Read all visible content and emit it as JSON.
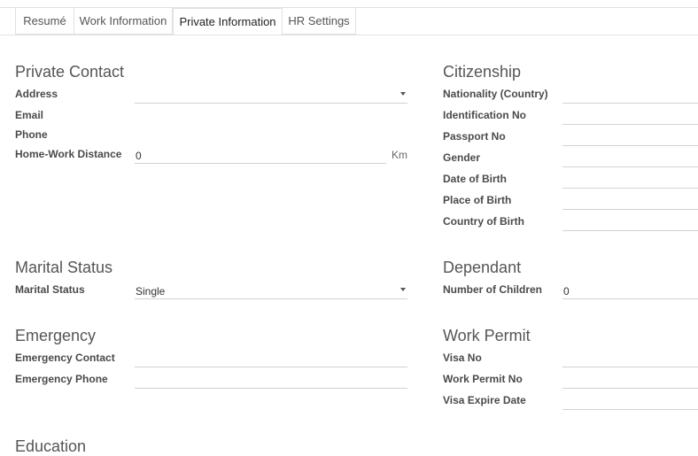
{
  "tabs": [
    "Resumé",
    "Work Information",
    "Private Information",
    "HR Settings"
  ],
  "private_contact": {
    "title": "Private Contact",
    "address_label": "Address",
    "email_label": "Email",
    "phone_label": "Phone",
    "distance_label": "Home-Work Distance",
    "distance_value": "0",
    "distance_unit": "Km"
  },
  "citizenship": {
    "title": "Citizenship",
    "nationality_label": "Nationality (Country)",
    "identification_label": "Identification No",
    "passport_label": "Passport No",
    "gender_label": "Gender",
    "dob_label": "Date of Birth",
    "pob_label": "Place of Birth",
    "cob_label": "Country of Birth"
  },
  "marital": {
    "title": "Marital Status",
    "label": "Marital Status",
    "value": "Single"
  },
  "dependant": {
    "title": "Dependant",
    "children_label": "Number of Children",
    "children_value": "0"
  },
  "emergency": {
    "title": "Emergency",
    "contact_label": "Emergency Contact",
    "phone_label": "Emergency Phone"
  },
  "work_permit": {
    "title": "Work Permit",
    "visa_label": "Visa No",
    "permit_label": "Work Permit No",
    "expire_label": "Visa Expire Date"
  },
  "education": {
    "title": "Education"
  }
}
